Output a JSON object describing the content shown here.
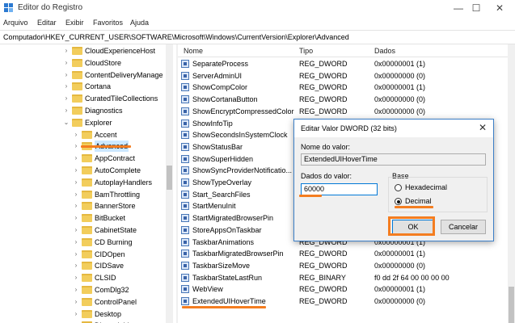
{
  "window": {
    "title": "Editor do Registro",
    "controls": {
      "minimize": "—",
      "maximize": "☐",
      "close": "✕"
    }
  },
  "menu": [
    "Arquivo",
    "Editar",
    "Exibir",
    "Favoritos",
    "Ajuda"
  ],
  "address": "Computador\\HKEY_CURRENT_USER\\SOFTWARE\\Microsoft\\Windows\\CurrentVersion\\Explorer\\Advanced",
  "tree": {
    "items": [
      {
        "label": "CloudExperienceHost"
      },
      {
        "label": "CloudStore"
      },
      {
        "label": "ContentDeliveryManage"
      },
      {
        "label": "Cortana"
      },
      {
        "label": "CuratedTileCollections"
      },
      {
        "label": "Diagnostics"
      },
      {
        "label": "Explorer"
      },
      {
        "label": "Accent"
      },
      {
        "label": "Advanced"
      },
      {
        "label": "AppContract"
      },
      {
        "label": "AutoComplete"
      },
      {
        "label": "AutoplayHandlers"
      },
      {
        "label": "BamThrottling"
      },
      {
        "label": "BannerStore"
      },
      {
        "label": "BitBucket"
      },
      {
        "label": "CabinetState"
      },
      {
        "label": "CD Burning"
      },
      {
        "label": "CIDOpen"
      },
      {
        "label": "CIDSave"
      },
      {
        "label": "CLSID"
      },
      {
        "label": "ComDlg32"
      },
      {
        "label": "ControlPanel"
      },
      {
        "label": "Desktop"
      },
      {
        "label": "Discardable"
      }
    ]
  },
  "list": {
    "headers": {
      "name": "Nome",
      "type": "Tipo",
      "data": "Dados"
    },
    "rows": [
      {
        "name": "SeparateProcess",
        "type": "REG_DWORD",
        "data": "0x00000001 (1)"
      },
      {
        "name": "ServerAdminUI",
        "type": "REG_DWORD",
        "data": "0x00000000 (0)"
      },
      {
        "name": "ShowCompColor",
        "type": "REG_DWORD",
        "data": "0x00000001 (1)"
      },
      {
        "name": "ShowCortanaButton",
        "type": "REG_DWORD",
        "data": "0x00000000 (0)"
      },
      {
        "name": "ShowEncryptCompressedColor",
        "type": "REG_DWORD",
        "data": "0x00000000 (0)"
      },
      {
        "name": "ShowInfoTip",
        "type": "",
        "data": ""
      },
      {
        "name": "ShowSecondsInSystemClock",
        "type": "",
        "data": ""
      },
      {
        "name": "ShowStatusBar",
        "type": "",
        "data": ""
      },
      {
        "name": "ShowSuperHidden",
        "type": "",
        "data": ""
      },
      {
        "name": "ShowSyncProviderNotificatio...",
        "type": "",
        "data": ""
      },
      {
        "name": "ShowTypeOverlay",
        "type": "",
        "data": ""
      },
      {
        "name": "Start_SearchFiles",
        "type": "",
        "data": ""
      },
      {
        "name": "StartMenuInit",
        "type": "",
        "data": ""
      },
      {
        "name": "StartMigratedBrowserPin",
        "type": "",
        "data": ""
      },
      {
        "name": "StoreAppsOnTaskbar",
        "type": "",
        "data": ""
      },
      {
        "name": "TaskbarAnimations",
        "type": "REG_DWORD",
        "data": "0x00000001 (1)"
      },
      {
        "name": "TaskbarMigratedBrowserPin",
        "type": "REG_DWORD",
        "data": "0x00000001 (1)"
      },
      {
        "name": "TaskbarSizeMove",
        "type": "REG_DWORD",
        "data": "0x00000000 (0)"
      },
      {
        "name": "TaskbarStateLastRun",
        "type": "REG_BINARY",
        "data": "f0 dd 2f 64 00 00 00 00"
      },
      {
        "name": "WebView",
        "type": "REG_DWORD",
        "data": "0x00000001 (1)"
      },
      {
        "name": "ExtendedUIHoverTime",
        "type": "REG_DWORD",
        "data": "0x00000000 (0)"
      }
    ]
  },
  "dialog": {
    "title": "Editar Valor DWORD (32 bits)",
    "close": "✕",
    "value_name_label": "Nome do valor:",
    "value_name": "ExtendedUIHoverTime",
    "value_data_label": "Dados do valor:",
    "value_data": "60000",
    "base_label": "Base",
    "base_hex": "Hexadecimal",
    "base_dec": "Decimal",
    "base_selected": "Decimal",
    "ok": "OK",
    "cancel": "Cancelar"
  },
  "colors": {
    "highlight": "#f47d20",
    "selection": "#cce8ff",
    "accent": "#0078d7"
  }
}
